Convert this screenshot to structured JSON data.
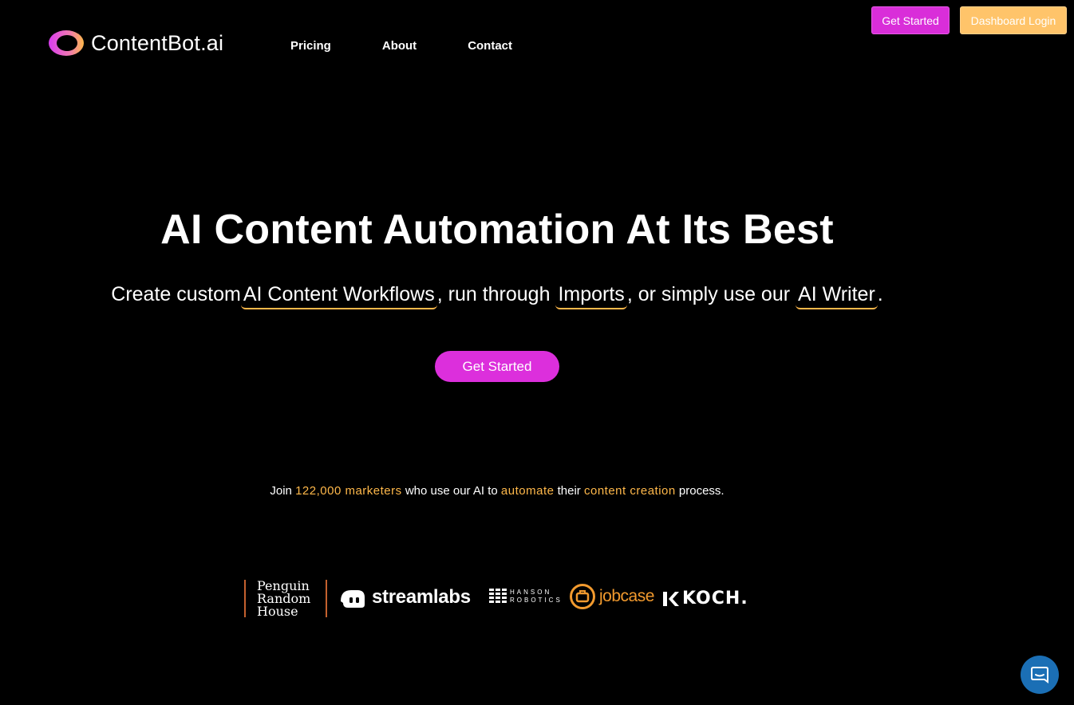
{
  "header": {
    "brand": "ContentBot.ai",
    "nav": {
      "pricing": "Pricing",
      "about": "About",
      "contact": "Contact"
    },
    "get_started_label": "Get Started",
    "dashboard_label": "Dashboard Login"
  },
  "hero": {
    "title": "AI Content Automation At Its Best",
    "sub_part1": "Create custom",
    "link_workflows": "AI Content Workflows",
    "sub_part2": ", run through",
    "link_imports": "Imports",
    "sub_part3": ", or simply use our",
    "link_writer": "AI Writer",
    "sub_part4": ".",
    "cta_label": "Get Started"
  },
  "social_proof": {
    "t1": "Join",
    "count": "122,000 marketers",
    "t2": "who use our AI to",
    "automate": "automate",
    "t3": "their",
    "content_creation": "content creation",
    "t4": "process."
  },
  "logos": {
    "penguin_line1": "Penguin",
    "penguin_line2": "Random",
    "penguin_line3": "House",
    "streamlabs": "streamlabs",
    "hanson_line1": "HANSON",
    "hanson_line2": "ROBOTICS",
    "jobcase": "jobcase",
    "koch": "KOCH."
  },
  "colors": {
    "background": "#000000",
    "magenta": "#dc2fdc",
    "orange": "#ffb84a",
    "dashboard_btn": "#ffc46a",
    "chat_btn": "#1b6fb5"
  },
  "icons": {
    "logo": "contentbot-ring-logo",
    "chat": "chat-bubble-icon"
  }
}
